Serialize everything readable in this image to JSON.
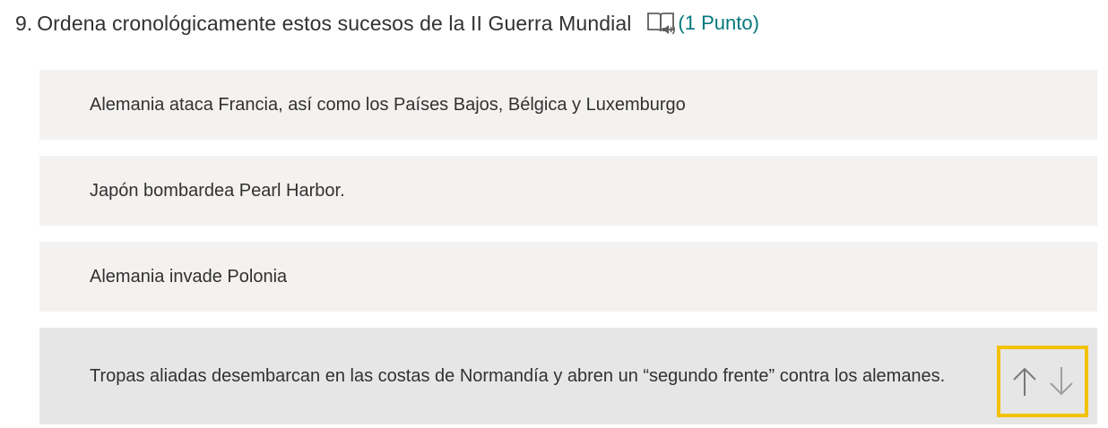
{
  "question": {
    "number": "9.",
    "title": "Ordena cronológicamente estos sucesos de la II Guerra Mundial",
    "points": "(1 Punto)",
    "reader_icon": "immersive-reader-icon"
  },
  "ranking": {
    "items": [
      {
        "label": "Alemania ataca Francia, así como los Países Bajos, Bélgica y Luxemburgo"
      },
      {
        "label": "Japón bombardea Pearl Harbor."
      },
      {
        "label": "Alemania invade Polonia"
      },
      {
        "label": "Tropas aliadas desembarcan en las costas de Normandía  y abren un “segundo frente” contra los alemanes."
      }
    ],
    "controls": {
      "up_icon": "arrow-up-icon",
      "down_icon": "arrow-down-icon"
    }
  },
  "colors": {
    "accent_points": "#03787c",
    "item_bg": "#f3f2f1",
    "item_bg_active": "#e6e6e6",
    "focus_highlight": "#f2c200",
    "text": "#323130",
    "arrow_disabled": "#a19f9d"
  }
}
